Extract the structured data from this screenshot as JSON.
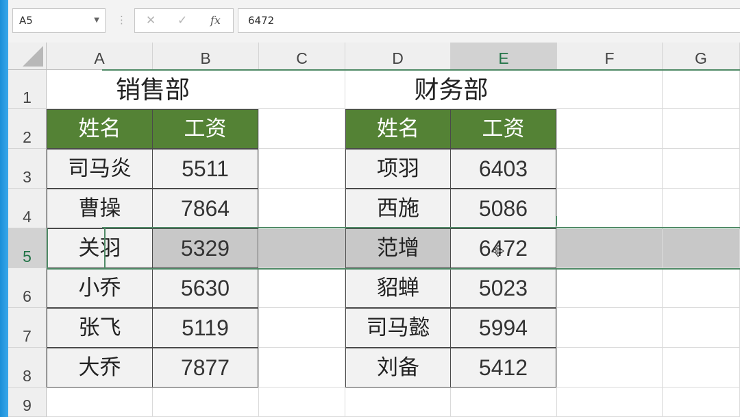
{
  "namebox": {
    "value": "A5"
  },
  "formula": {
    "fx": "fx",
    "cancel": "✕",
    "enter": "✓",
    "value": "6472"
  },
  "columns": [
    "A",
    "B",
    "C",
    "D",
    "E",
    "F",
    "G"
  ],
  "rows": [
    "1",
    "2",
    "3",
    "4",
    "5",
    "6",
    "7",
    "8",
    "9"
  ],
  "sales": {
    "title": "销售部",
    "header": [
      "姓名",
      "工资"
    ],
    "rows": [
      [
        "司马炎",
        "5511"
      ],
      [
        "曹操",
        "7864"
      ],
      [
        "关羽",
        "5329"
      ],
      [
        "小乔",
        "5630"
      ],
      [
        "张飞",
        "5119"
      ],
      [
        "大乔",
        "7877"
      ]
    ]
  },
  "finance": {
    "title": "财务部",
    "header": [
      "姓名",
      "工资"
    ],
    "rows": [
      [
        "项羽",
        "6403"
      ],
      [
        "西施",
        "5086"
      ],
      [
        "范增",
        "6472"
      ],
      [
        "貂蝉",
        "5023"
      ],
      [
        "司马懿",
        "5994"
      ],
      [
        "刘备",
        "5412"
      ]
    ]
  },
  "colors": {
    "header_fill": "#548235",
    "selection": "#c8c8c8",
    "drag_outline": "#4f8a66"
  }
}
